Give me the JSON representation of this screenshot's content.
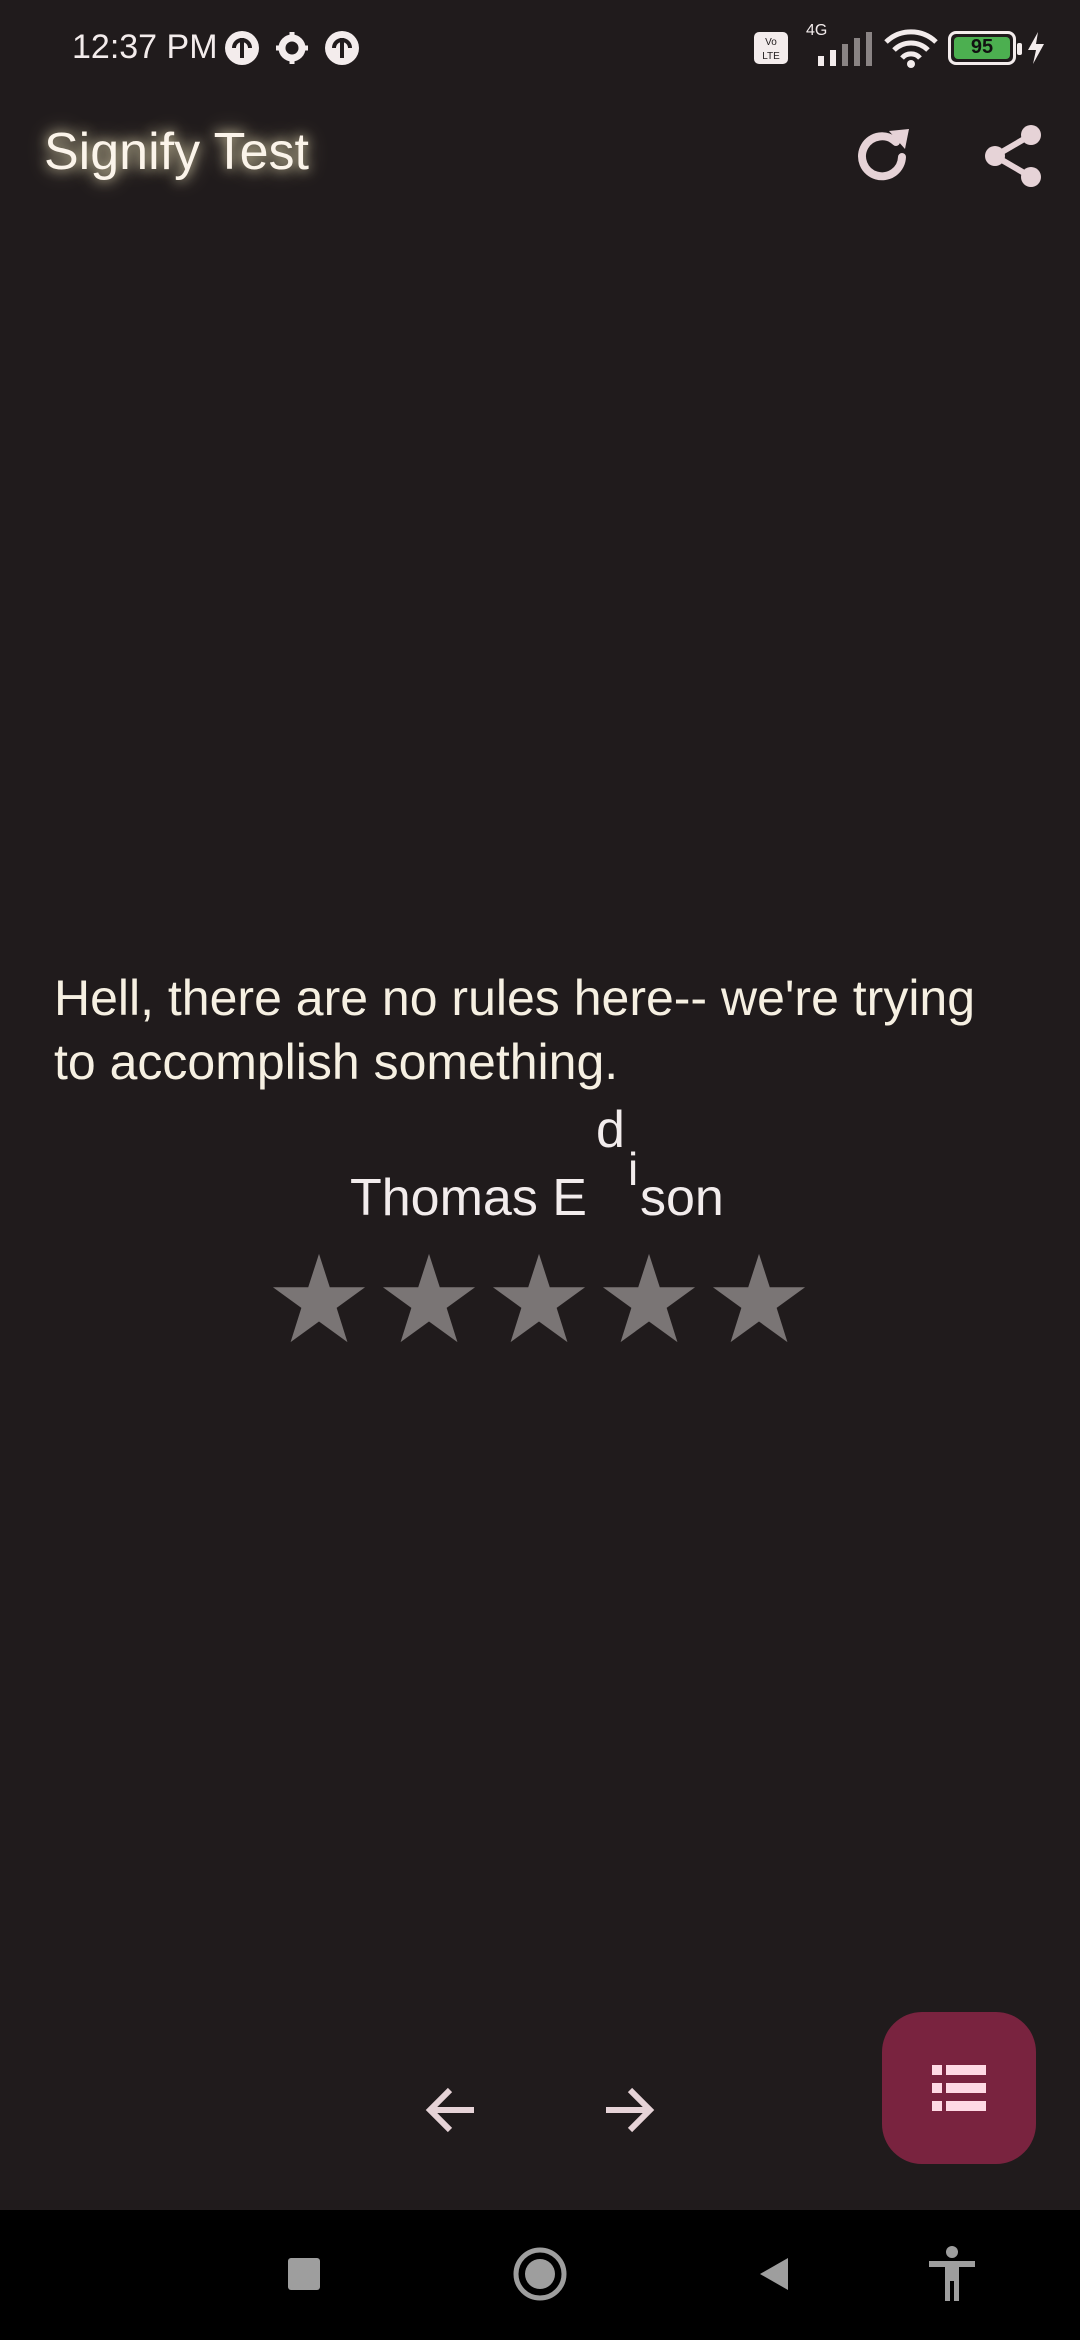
{
  "status_bar": {
    "time": "12:37 PM",
    "network_type": "4G",
    "volte": "Vo LTE",
    "battery_percent": "95",
    "icons": [
      "notification-icon",
      "settings-icon",
      "notification-icon",
      "volte-icon",
      "signal-icon",
      "wifi-icon",
      "battery-icon",
      "charging-icon"
    ],
    "colors": {
      "battery": "#4caf50"
    }
  },
  "toolbar": {
    "title": "Signify Test",
    "actions": [
      "refresh-icon",
      "share-icon"
    ]
  },
  "quote": {
    "text": "Hell, there are no rules here-- we're trying to accomplish something.",
    "author_prefix": "Thomas E",
    "author_d": "d",
    "author_i": "i",
    "author_suffix": "son"
  },
  "rating": {
    "max": 5,
    "value": 0,
    "star_color": "#7a7575"
  },
  "navigation": {
    "previous_icon": "arrow-left-icon",
    "next_icon": "arrow-right-icon",
    "fab_icon": "list-icon",
    "fab_color": "#79233f"
  },
  "system_nav": {
    "buttons": [
      "recents-icon",
      "home-icon",
      "back-icon",
      "accessibility-icon"
    ]
  }
}
